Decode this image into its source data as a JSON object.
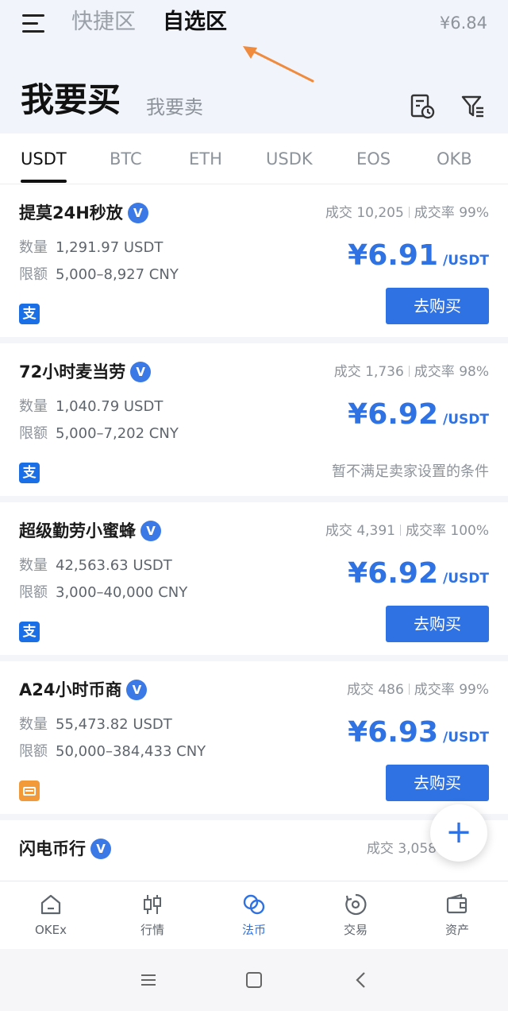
{
  "header": {
    "zone_quick": "快捷区",
    "zone_favorites": "自选区",
    "balance": "¥6.84",
    "buy_title": "我要买",
    "sell_title": "我要卖"
  },
  "coins": [
    "USDT",
    "BTC",
    "ETH",
    "USDK",
    "EOS",
    "OKB"
  ],
  "active_coin": "USDT",
  "labels": {
    "qty": "数量",
    "limit": "限额",
    "trades": "成交",
    "rate": "成交率",
    "buy_button": "去购买"
  },
  "merchants": [
    {
      "name": "提莫24H秒放",
      "trades": "10,205",
      "rate": "99%",
      "qty": "1,291.97 USDT",
      "limit": "5,000–8,927 CNY",
      "price": "¥6.91",
      "unit": "/USDT",
      "payment": "alipay-icon"
    },
    {
      "name": "72小时麦当劳",
      "trades": "1,736",
      "rate": "98%",
      "qty": "1,040.79 USDT",
      "limit": "5,000–7,202 CNY",
      "price": "¥6.92",
      "unit": "/USDT",
      "payment": "alipay-icon",
      "note": "暂不满足卖家设置的条件"
    },
    {
      "name": "超级勤劳小蜜蜂",
      "trades": "4,391",
      "rate": "100%",
      "qty": "42,563.63 USDT",
      "limit": "3,000–40,000 CNY",
      "price": "¥6.92",
      "unit": "/USDT",
      "payment": "alipay-icon"
    },
    {
      "name": "A24小时币商",
      "trades": "486",
      "rate": "99%",
      "qty": "55,473.82 USDT",
      "limit": "50,000–384,433 CNY",
      "price": "¥6.93",
      "unit": "/USDT",
      "payment": "bank-card-icon"
    },
    {
      "name": "闪电币行",
      "trades": "3,058",
      "rate": "",
      "qty": "",
      "limit": "",
      "price": "",
      "unit": "",
      "payment": ""
    }
  ],
  "alipay_glyph": "支",
  "verified_glyph": "V",
  "fab_glyph": "+",
  "bottom_nav": [
    {
      "label": "OKEx",
      "icon": "home-icon"
    },
    {
      "label": "行情",
      "icon": "candlestick-icon"
    },
    {
      "label": "法币",
      "icon": "fiat-icon"
    },
    {
      "label": "交易",
      "icon": "trade-icon"
    },
    {
      "label": "资产",
      "icon": "wallet-icon"
    }
  ],
  "active_nav": "法币",
  "colors": {
    "accent": "#2f72e4",
    "header_bg": "#f1f4fa",
    "alipay": "#1a6ee6",
    "bank": "#f29a3a",
    "arrow": "#f08a3c"
  }
}
